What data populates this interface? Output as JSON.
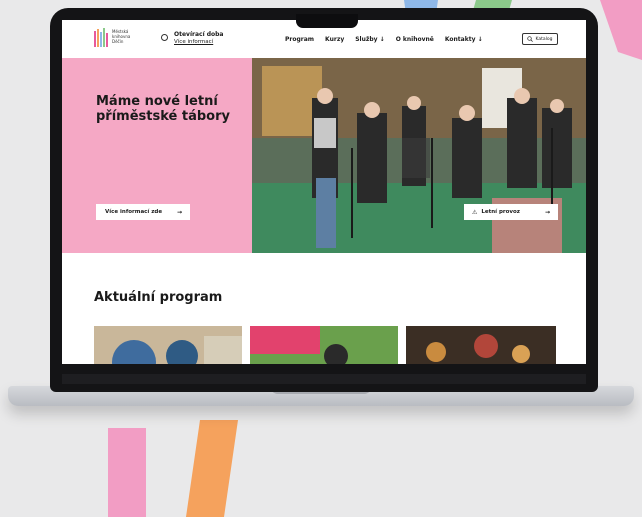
{
  "colors": {
    "background": "#e9e9ea",
    "hero_pink": "#f5a8c5",
    "stripe_pink": "#f29dc4",
    "stripe_orange": "#f5a25d",
    "stripe_blue": "#8fb8e8",
    "stripe_green": "#8bc98a",
    "text_dark": "#1a1a1a"
  },
  "header": {
    "logo_text": "Městská knihovna Děčín",
    "opening_hours_title": "Otevírací doba",
    "opening_hours_link": "Více informací",
    "nav": [
      "Program",
      "Kurzy",
      "Služby ↓",
      "O knihovně",
      "Kontakty ↓"
    ],
    "catalog_label": "Katalog"
  },
  "hero": {
    "title": "Máme nové letní příměstské tábory",
    "more_button": "Více informací zde",
    "summer_button": "Letní provoz"
  },
  "program": {
    "title": "Aktuální program"
  },
  "icons": [
    "clock-icon",
    "search-icon",
    "arrow-right-icon",
    "warning-icon"
  ]
}
